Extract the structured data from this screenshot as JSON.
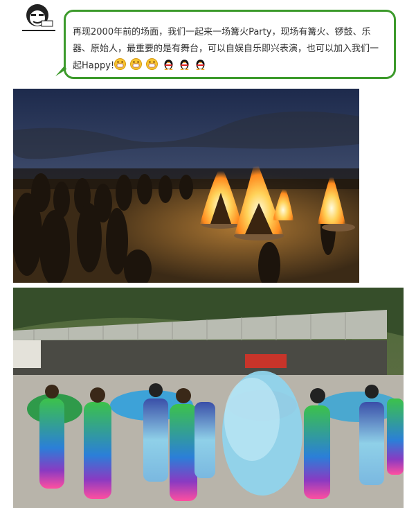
{
  "post": {
    "bubble_text": "再现2000年前的场面，我们一起来一场篝火Party，现场有篝火、锣鼓、乐器、原始人，最重要的是有舞台，可以自娱自乐即兴表演，也可以加入我们一起Happy!",
    "emojis": [
      "grin-emoji",
      "grin-emoji",
      "grin-emoji",
      "penguin-emoji",
      "penguin-emoji",
      "penguin-emoji"
    ]
  },
  "colors": {
    "bubble_border": "#3c9a2b",
    "text": "#333333"
  }
}
